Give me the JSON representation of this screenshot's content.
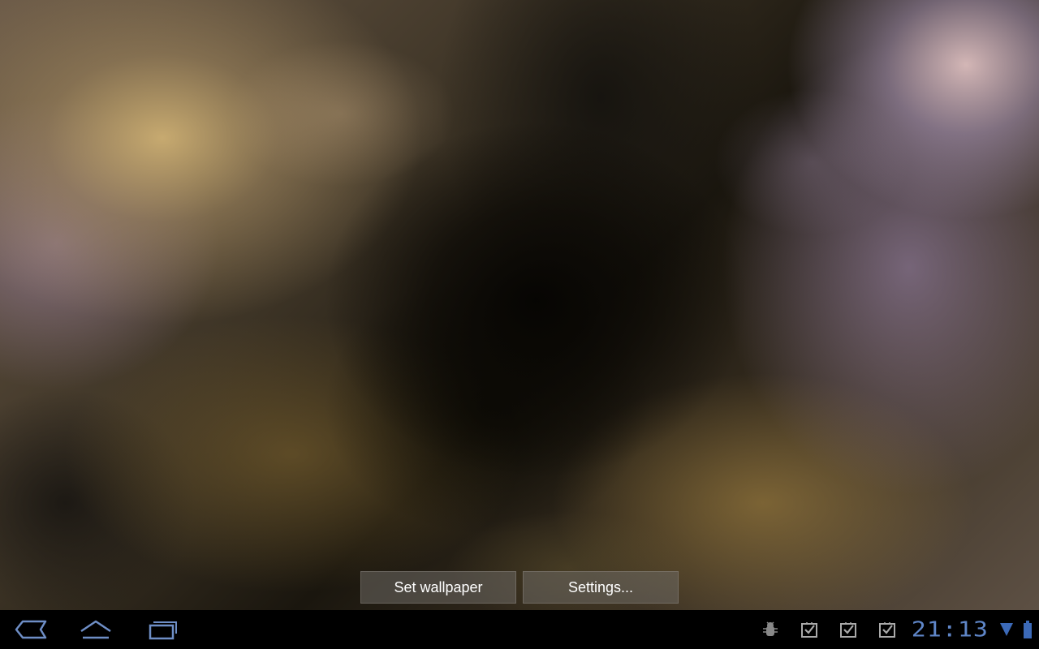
{
  "wallpaper_actions": {
    "set_wallpaper_label": "Set wallpaper",
    "settings_label": "Settings..."
  },
  "system_bar": {
    "nav_icons": [
      "back-icon",
      "home-icon",
      "recent-apps-icon"
    ],
    "status_icons": [
      "android-debug-icon",
      "download-done-icon",
      "download-done-icon",
      "download-done-icon",
      "wifi-signal-icon",
      "battery-icon"
    ],
    "clock": "21:13",
    "accent_color": "#5f86c8"
  }
}
